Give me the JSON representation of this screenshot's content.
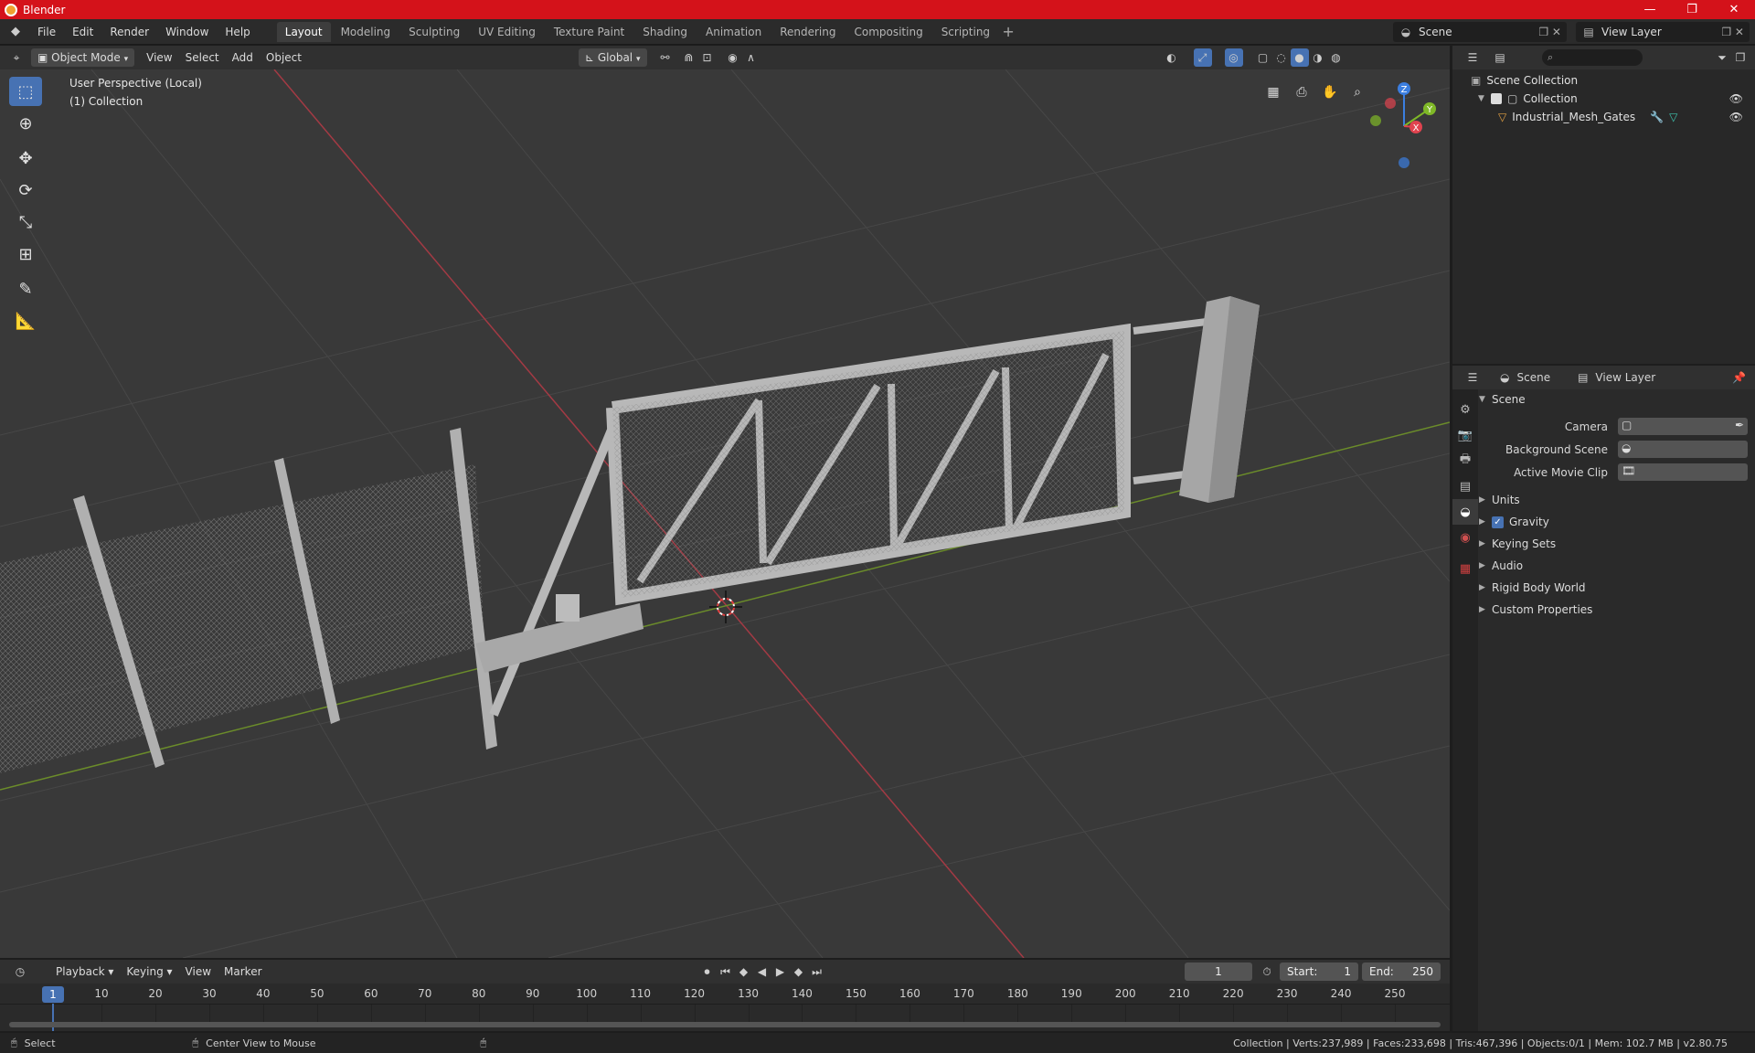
{
  "window": {
    "title": "Blender",
    "controls": [
      "—",
      "❐",
      "✕"
    ]
  },
  "menu": [
    "File",
    "Edit",
    "Render",
    "Window",
    "Help"
  ],
  "workspaces": [
    "Layout",
    "Modeling",
    "Sculpting",
    "UV Editing",
    "Texture Paint",
    "Shading",
    "Animation",
    "Rendering",
    "Compositing",
    "Scripting"
  ],
  "active_workspace": "Layout",
  "scene_selector": {
    "scene": "Scene",
    "view_layer": "View Layer"
  },
  "viewport_header": {
    "mode": "Object Mode",
    "menus": [
      "View",
      "Select",
      "Add",
      "Object"
    ],
    "transform_orientation": "Global"
  },
  "viewport": {
    "perspective_label": "User Perspective (Local)",
    "collection_label": "(1) Collection",
    "gizmo_axes": {
      "x": "X",
      "y": "Y",
      "z": "Z"
    }
  },
  "outliner": {
    "search_placeholder": "",
    "root": "Scene Collection",
    "collection": "Collection",
    "object": "Industrial_Mesh_Gates"
  },
  "properties": {
    "header_scene": "Scene",
    "header_view_layer": "View Layer",
    "panel": "Scene",
    "fields": [
      {
        "label": "Camera",
        "value": ""
      },
      {
        "label": "Background Scene",
        "value": ""
      },
      {
        "label": "Active Movie Clip",
        "value": ""
      }
    ],
    "subpanels": [
      "Units",
      "Gravity",
      "Keying Sets",
      "Audio",
      "Rigid Body World",
      "Custom Properties"
    ],
    "gravity_checked": true
  },
  "timeline": {
    "menus": [
      "Playback",
      "Keying",
      "View",
      "Marker"
    ],
    "current_frame": "1",
    "start_label": "Start:",
    "start": "1",
    "end_label": "End:",
    "end": "250",
    "ticks": [
      "1",
      "10",
      "20",
      "30",
      "40",
      "50",
      "60",
      "70",
      "80",
      "90",
      "100",
      "110",
      "120",
      "130",
      "140",
      "150",
      "160",
      "170",
      "180",
      "190",
      "200",
      "210",
      "220",
      "230",
      "240",
      "250"
    ]
  },
  "statusbar": {
    "left_action": "Select",
    "middle_action": "Center View to Mouse",
    "stats": "Collection | Verts:237,989 | Faces:233,698 | Tris:467,396 | Objects:0/1 | Mem: 102.7 MB | v2.80.75"
  },
  "colors": {
    "accent": "#4772b3",
    "titlebar": "#d4121a",
    "x_axis": "#e0434f",
    "y_axis": "#7fb827",
    "z_axis": "#3b7ee0"
  }
}
